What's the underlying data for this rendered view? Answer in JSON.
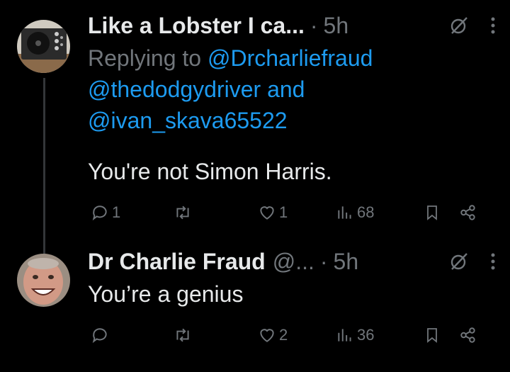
{
  "tweet1": {
    "name": "Like a Lobster I ca...",
    "dot": "·",
    "time": "5h",
    "replying_prefix": "Replying to ",
    "mention1": "@Drcharliefraud",
    "mention2": "@thedodgydriver",
    "and_word": " and",
    "mention3": "@ivan_skava65522",
    "text": "You're not Simon Harris.",
    "reply_count": "1",
    "retweet_count": "",
    "like_count": "1",
    "view_count": "68"
  },
  "tweet2": {
    "name": "Dr Charlie Fraud",
    "handle": "@...",
    "dot": "·",
    "time": "5h",
    "text": "You’re a genius",
    "reply_count": "",
    "retweet_count": "",
    "like_count": "2",
    "view_count": "36"
  },
  "icons": [
    "reply-icon",
    "retweet-icon",
    "like-icon",
    "views-icon",
    "bookmark-icon",
    "share-icon",
    "grok-icon",
    "more-icon"
  ],
  "colors": {
    "background": "#000000",
    "text": "#e7e9ea",
    "muted": "#71767b",
    "link": "#1d9bf0"
  }
}
